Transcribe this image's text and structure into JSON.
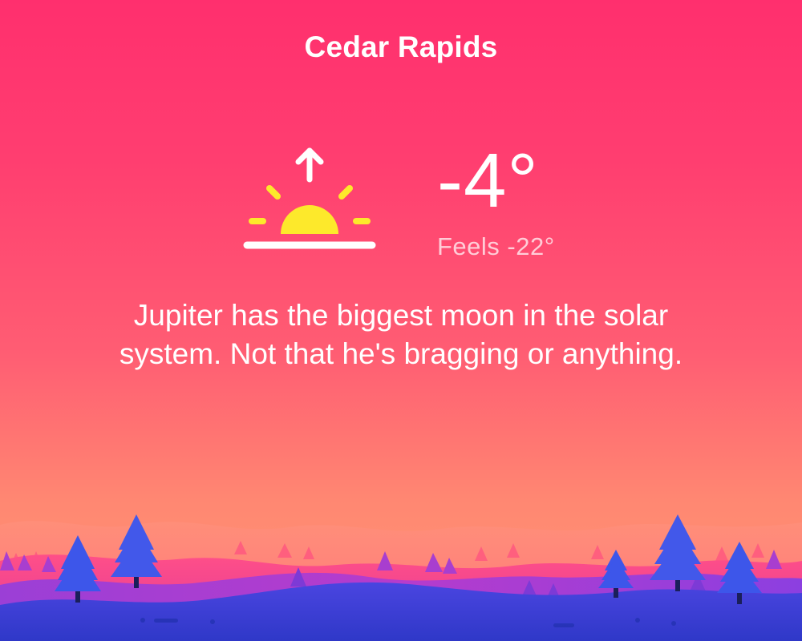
{
  "location": {
    "city": "Cedar Rapids"
  },
  "current": {
    "condition_icon": "sunrise-icon",
    "temperature": "-4°",
    "feels_like": "Feels -22°"
  },
  "fact": {
    "text": "Jupiter has the biggest moon in the solar system. Not that he's bragging or anything."
  },
  "colors": {
    "background_top": "#ff2f6e",
    "background_bottom": "#ff9a75",
    "sun": "#fde92b",
    "text": "#ffffff",
    "trees": "#3a4de0",
    "hills_front": "#3b41d6",
    "hills_back": "#b83ccf"
  }
}
